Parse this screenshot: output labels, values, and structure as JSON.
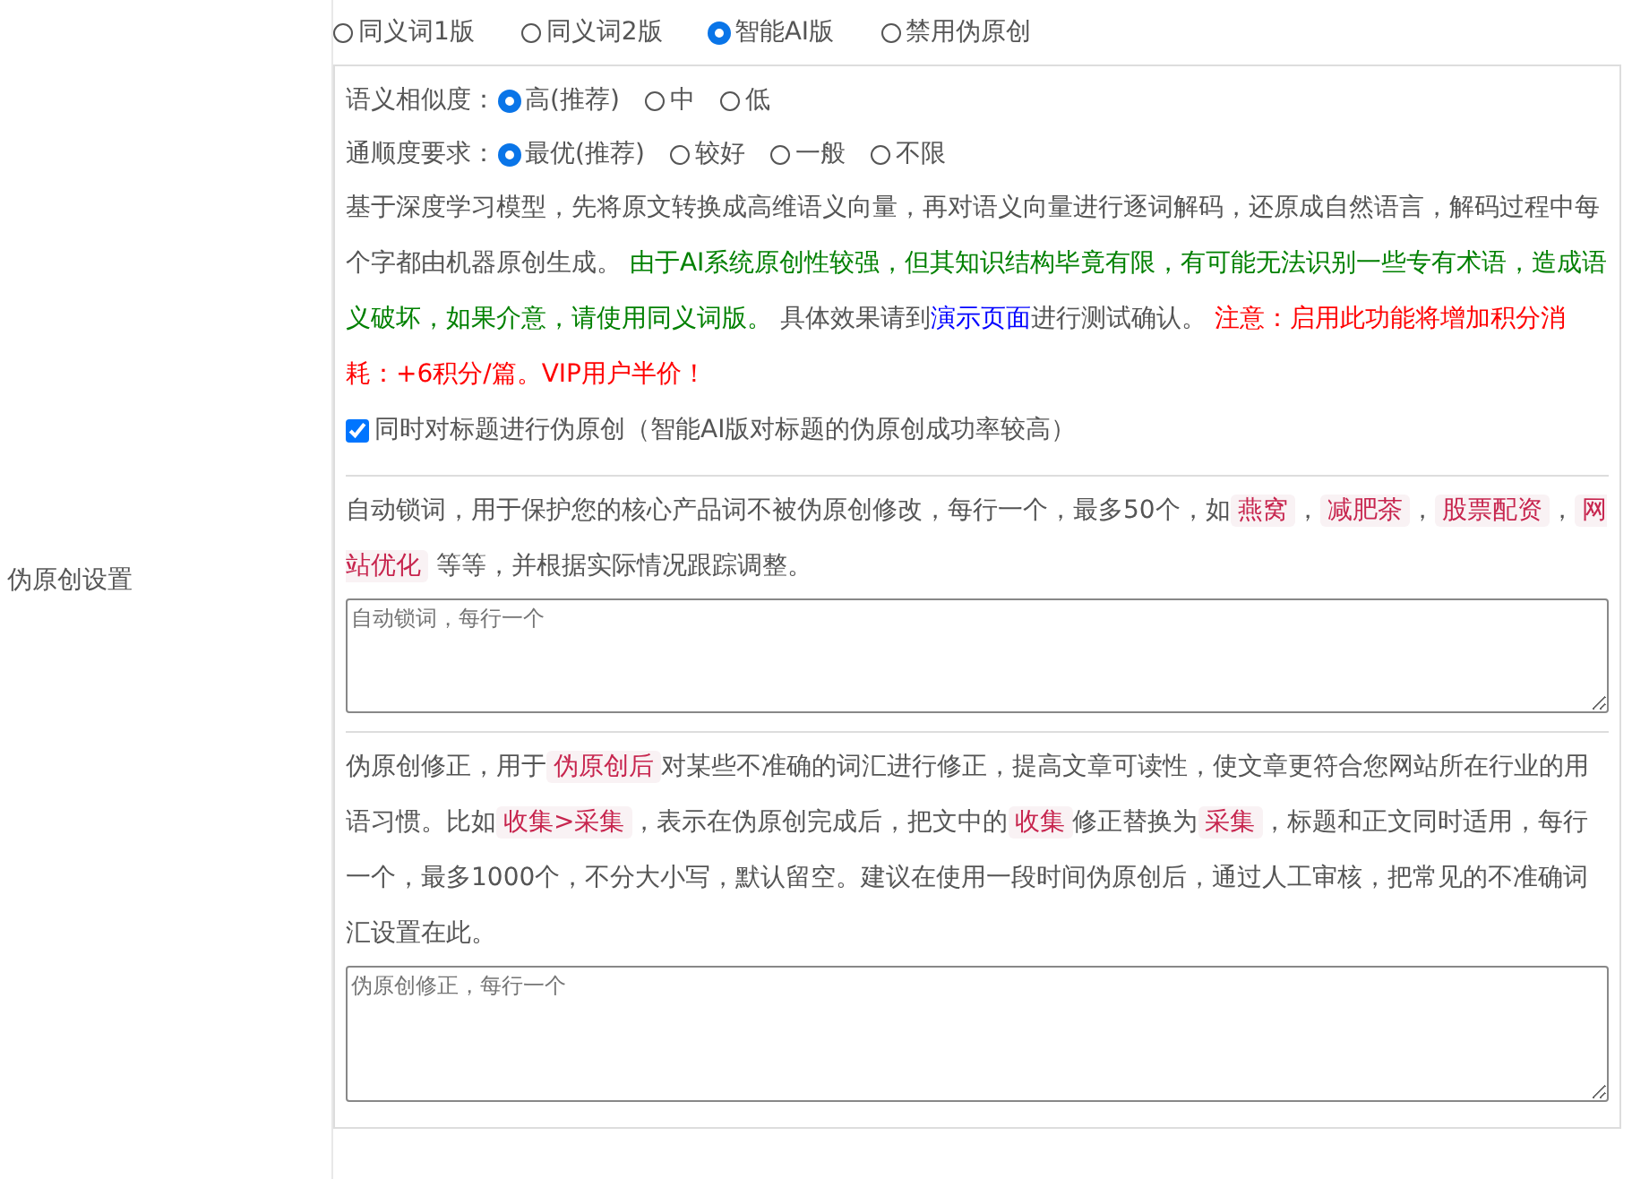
{
  "label": "伪原创设置",
  "modes": [
    {
      "label": "同义词1版",
      "selected": false
    },
    {
      "label": "同义词2版",
      "selected": false
    },
    {
      "label": "智能AI版",
      "selected": true
    },
    {
      "label": "禁用伪原创",
      "selected": false
    }
  ],
  "settings": [
    {
      "label": "语义相似度：",
      "options": [
        {
          "label": "高(推荐)",
          "selected": true
        },
        {
          "label": "中",
          "selected": false
        },
        {
          "label": "低",
          "selected": false
        }
      ]
    },
    {
      "label": "通顺度要求：",
      "options": [
        {
          "label": "最优(推荐)",
          "selected": true
        },
        {
          "label": "较好",
          "selected": false
        },
        {
          "label": "一般",
          "selected": false
        },
        {
          "label": "不限",
          "selected": false
        }
      ]
    }
  ],
  "description": [
    {
      "kind": "plain",
      "text": "基于深度学习模型，先将原文转换成高维语义向量，再对语义向量进行逐词解码，还原成自然语言，解码过程中每个字都由机器原创生成。 "
    },
    {
      "kind": "green",
      "text": "由于AI系统原创性较强，但其知识结构毕竟有限，有可能无法识别一些专有术语，造成语义破坏，如果介意，请使用同义词版。"
    },
    {
      "kind": "plain",
      "text": " 具体效果请到"
    },
    {
      "kind": "link",
      "text": "演示页面"
    },
    {
      "kind": "plain",
      "text": "进行测试确认。 "
    },
    {
      "kind": "red",
      "text": "注意：启用此功能将增加积分消耗：+6积分/篇。VIP用户半价！"
    }
  ],
  "title_option": {
    "label": "同时对标题进行伪原创（智能AI版对标题的伪原创成功率较高）",
    "checked": true
  },
  "lock_words": {
    "description": [
      {
        "kind": "plain",
        "text": "自动锁词，用于保护您的核心产品词不被伪原创修改，每行一个，最多50个，如"
      },
      {
        "kind": "tag",
        "text": "燕窝"
      },
      {
        "kind": "plain",
        "text": "，"
      },
      {
        "kind": "tag",
        "text": "减肥茶"
      },
      {
        "kind": "plain",
        "text": "，"
      },
      {
        "kind": "tag",
        "text": "股票配资"
      },
      {
        "kind": "plain",
        "text": "，"
      },
      {
        "kind": "tag",
        "text": "网站优化"
      },
      {
        "kind": "plain",
        "text": " 等等，并根据实际情况跟踪调整。"
      }
    ],
    "placeholder": "自动锁词，每行一个"
  },
  "corrections": {
    "description": [
      {
        "kind": "plain",
        "text": "伪原创修正，用于"
      },
      {
        "kind": "tag",
        "text": "伪原创后"
      },
      {
        "kind": "plain",
        "text": "对某些不准确的词汇进行修正，提高文章可读性，使文章更符合您网站所在行业的用语习惯。比如"
      },
      {
        "kind": "tag",
        "text": "收集>采集"
      },
      {
        "kind": "plain",
        "text": "，表示在伪原创完成后，把文中的"
      },
      {
        "kind": "tag",
        "text": "收集"
      },
      {
        "kind": "plain",
        "text": "修正替换为"
      },
      {
        "kind": "tag",
        "text": "采集"
      },
      {
        "kind": "plain",
        "text": "，标题和正文同时适用，每行一个，最多1000个，不分大小写，默认留空。建议在使用一段时间伪原创后，通过人工审核，把常见的不准确词汇设置在此。"
      }
    ],
    "placeholder": "伪原创修正，每行一个"
  }
}
